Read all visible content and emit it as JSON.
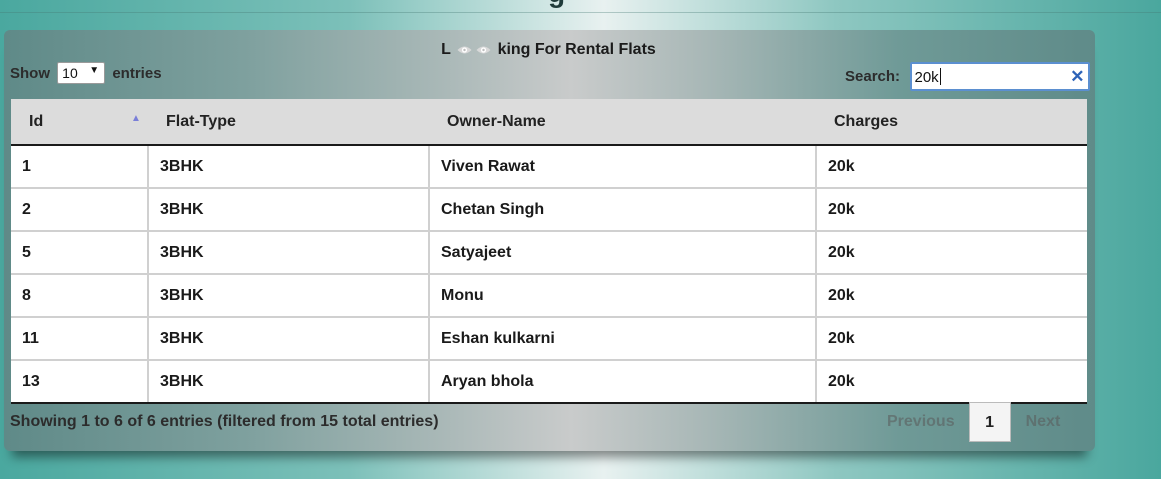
{
  "heading_fragment": "g",
  "panel": {
    "title_prefix": "L",
    "title_suffix": "king For Rental Flats",
    "eye_icon_color": "#d8d8d8"
  },
  "length": {
    "show_label": "Show",
    "selected": "10",
    "entries_label": "entries"
  },
  "search": {
    "label": "Search:",
    "value": "20k",
    "clear_symbol": "✕"
  },
  "table": {
    "sort_indicator": "▲",
    "columns": [
      "Id",
      "Flat-Type",
      "Owner-Name",
      "Charges"
    ],
    "rows": [
      [
        "1",
        "3BHK",
        "Viven Rawat",
        "20k"
      ],
      [
        "2",
        "3BHK",
        "Chetan Singh",
        "20k"
      ],
      [
        "5",
        "3BHK",
        "Satyajeet",
        "20k"
      ],
      [
        "8",
        "3BHK",
        "Monu",
        "20k"
      ],
      [
        "11",
        "3BHK",
        "Eshan kulkarni",
        "20k"
      ],
      [
        "13",
        "3BHK",
        "Aryan bhola",
        "20k"
      ]
    ]
  },
  "info": "Showing 1 to 6 of 6 entries (filtered from 15 total entries)",
  "pagination": {
    "previous": "Previous",
    "current_page": "1",
    "next": "Next"
  },
  "colors": {
    "background_teal": "#4aa89f",
    "search_border": "#5b8fd0",
    "sort_arrow": "#7a7fd8"
  }
}
